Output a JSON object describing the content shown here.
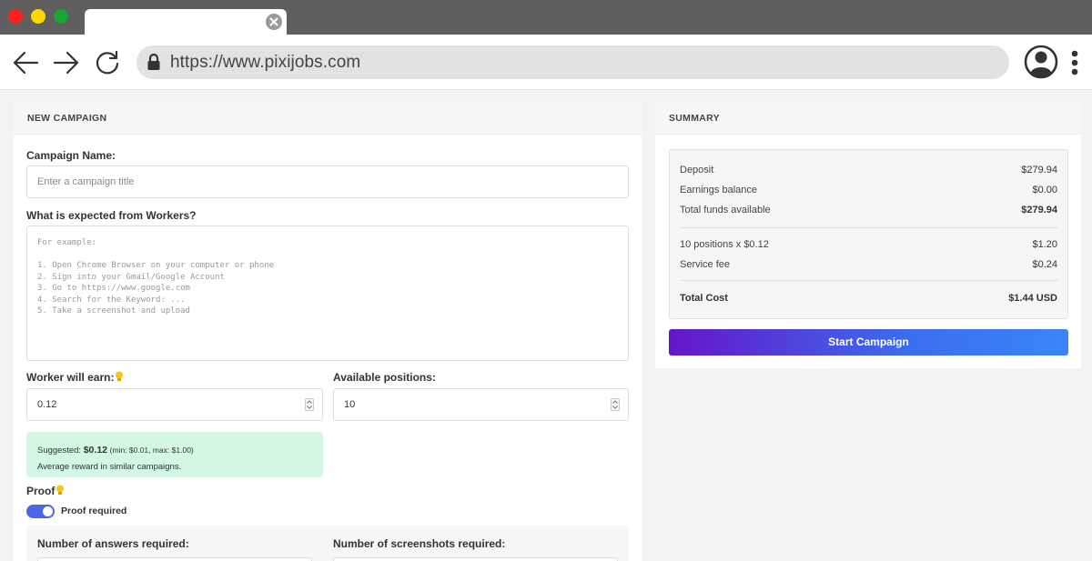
{
  "browser": {
    "url": "https://www.pixijobs.com"
  },
  "campaign": {
    "header": "NEW CAMPAIGN",
    "name_label": "Campaign Name:",
    "name_placeholder": "Enter a campaign title",
    "expected_label": "What is expected from Workers?",
    "expected_placeholder": "For example:\n\n1. Open Chrome Browser on your computer or phone\n2. Sign into your Gmail/Google Account\n3. Go to https://www.google.com\n4. Search for the Keyword: ...\n5. Take a screenshot and upload",
    "earn_label": "Worker will earn:",
    "earn_value": "0.12",
    "positions_label": "Available positions:",
    "positions_value": "10",
    "hint_prefix": "Suggested:",
    "hint_value": "$0.12",
    "hint_range": "(min: $0.01, max: $1.00)",
    "hint_note": "Average reward in similar campaigns.",
    "proof_label": "Proof",
    "proof_toggle_label": "Proof required",
    "proof_toggle_on": true,
    "answers_label": "Number of answers required:",
    "screenshots_label": "Number of screenshots required:"
  },
  "summary": {
    "header": "SUMMARY",
    "rows": [
      {
        "label": "Deposit",
        "value": "$279.94"
      },
      {
        "label": "Earnings balance",
        "value": "$0.00"
      },
      {
        "label": "Total funds available",
        "value": "$279.94"
      },
      {
        "label": "10 positions x $0.12",
        "value": "$1.20"
      },
      {
        "label": "Service fee",
        "value": "$0.24"
      },
      {
        "label": "Total Cost",
        "value": "$1.44 USD"
      }
    ],
    "start_button": "Start Campaign"
  },
  "colors": {
    "accent_gradient_start": "#6515c9",
    "accent_gradient_end": "#3a86f5",
    "toggle_on": "#4c66e6",
    "hint_bg": "#d4f7e4"
  }
}
